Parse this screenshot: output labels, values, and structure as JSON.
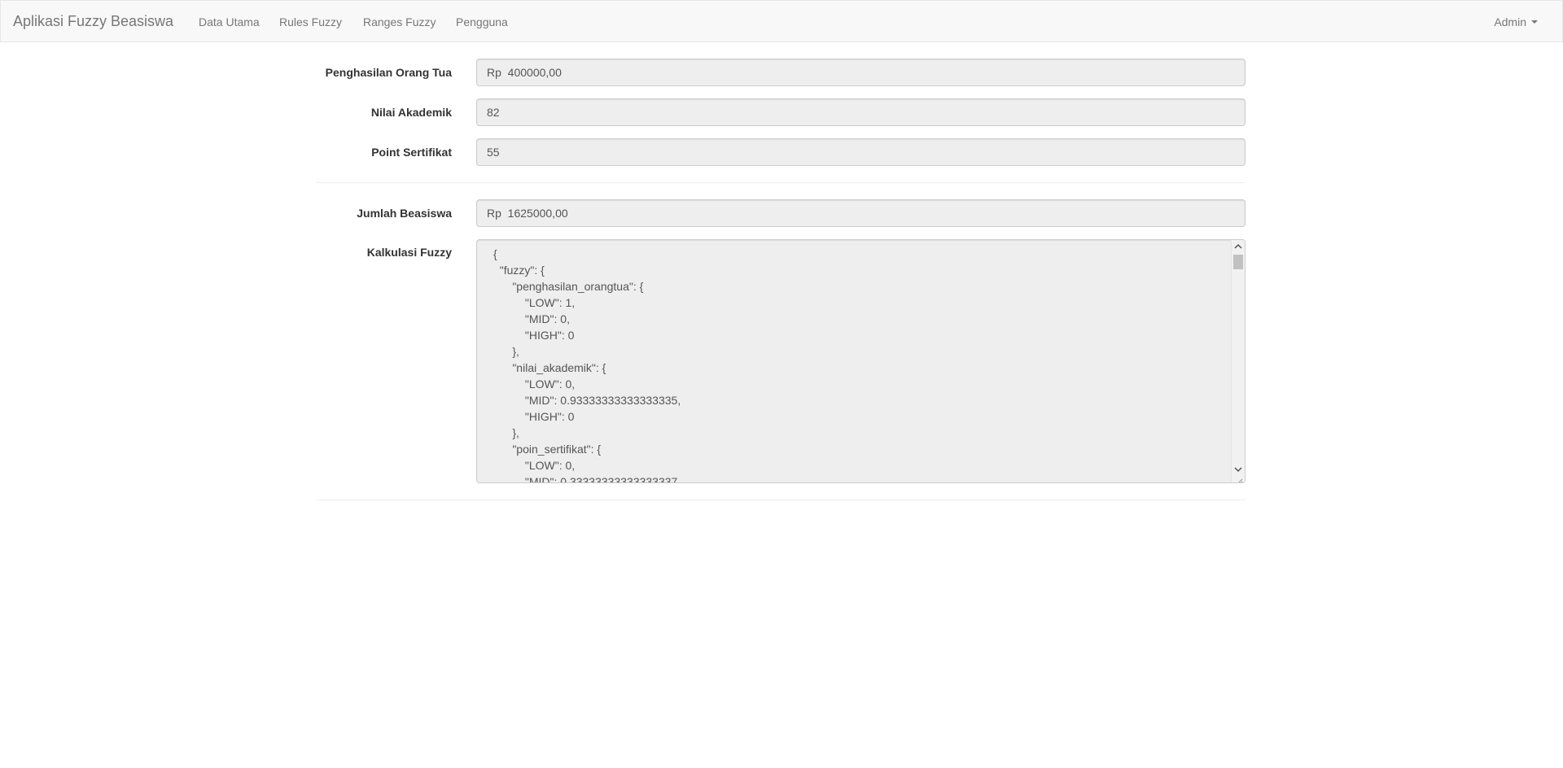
{
  "navbar": {
    "brand": "Aplikasi Fuzzy Beasiswa",
    "links": [
      "Data Utama",
      "Rules Fuzzy",
      "Ranges Fuzzy",
      "Pengguna"
    ],
    "user_menu": "Admin"
  },
  "form": {
    "penghasilan": {
      "label": "Penghasilan Orang Tua",
      "value": "Rp  400000,00"
    },
    "nilai": {
      "label": "Nilai Akademik",
      "value": "82"
    },
    "point": {
      "label": "Point Sertifikat",
      "value": "55"
    },
    "jumlah": {
      "label": "Jumlah Beasiswa",
      "value": "Rp  1625000,00"
    },
    "kalkulasi": {
      "label": "Kalkulasi Fuzzy",
      "value": "{\n  \"fuzzy\": {\n      \"penghasilan_orangtua\": {\n          \"LOW\": 1,\n          \"MID\": 0,\n          \"HIGH\": 0\n      },\n      \"nilai_akademik\": {\n          \"LOW\": 0,\n          \"MID\": 0.93333333333333335,\n          \"HIGH\": 0\n      },\n      \"poin_sertifikat\": {\n          \"LOW\": 0,\n          \"MID\": 0.33333333333333337"
    }
  },
  "icons": {
    "caret": "caret-down-icon",
    "scroll_up": "chevron-up-icon",
    "scroll_down": "chevron-down-icon",
    "resize": "resize-grip-icon"
  },
  "colors": {
    "navbar_bg": "#f8f8f8",
    "nav_text": "#777777",
    "readonly_bg": "#eeeeee"
  }
}
